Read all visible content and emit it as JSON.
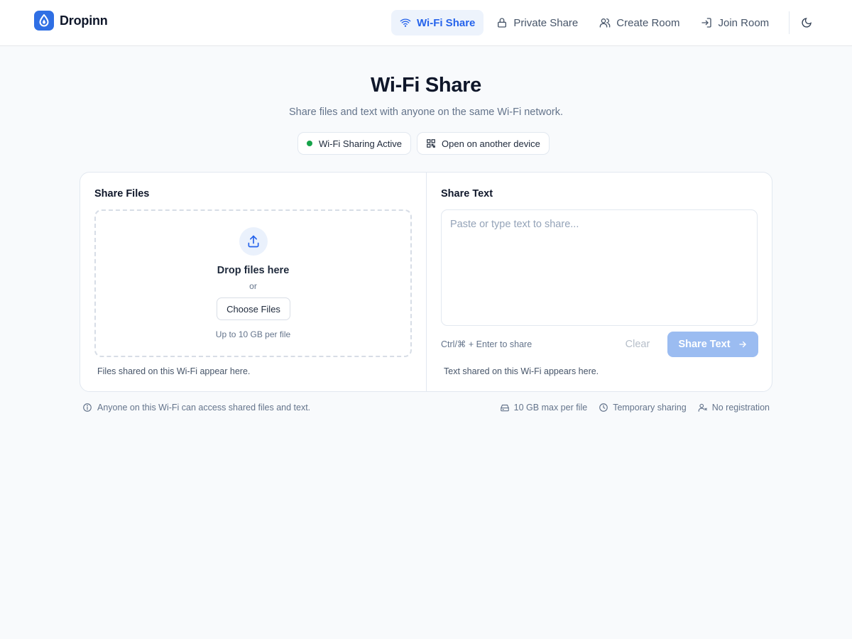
{
  "app": {
    "name": "Dropinn"
  },
  "nav": {
    "items": [
      {
        "label": "Wi-Fi Share",
        "icon": "wifi-icon",
        "active": true
      },
      {
        "label": "Private Share",
        "icon": "lock-icon",
        "active": false
      },
      {
        "label": "Create Room",
        "icon": "users-icon",
        "active": false
      },
      {
        "label": "Join Room",
        "icon": "login-icon",
        "active": false
      }
    ],
    "theme_toggle_icon": "moon-icon"
  },
  "hero": {
    "title": "Wi-Fi Share",
    "subtitle": "Share files and text with anyone on the same Wi-Fi network.",
    "status_pill": "Wi-Fi Sharing Active",
    "device_pill": "Open on another device"
  },
  "files": {
    "title": "Share Files",
    "drop_title": "Drop files here",
    "or": "or",
    "choose_label": "Choose Files",
    "limit": "Up to 10 GB per file",
    "empty_hint": "Files shared on this Wi-Fi appear here."
  },
  "text": {
    "title": "Share Text",
    "placeholder": "Paste or type text to share...",
    "value": "",
    "shortcut": "Ctrl/⌘ + Enter to share",
    "clear_label": "Clear",
    "share_label": "Share Text",
    "empty_hint": "Text shared on this Wi-Fi appears here."
  },
  "footer": {
    "notice": "Anyone on this Wi-Fi can access shared files and text.",
    "features": [
      {
        "label": "10 GB max per file",
        "icon": "drive-icon"
      },
      {
        "label": "Temporary sharing",
        "icon": "clock-icon"
      },
      {
        "label": "No registration",
        "icon": "user-x-icon"
      }
    ]
  },
  "colors": {
    "accent": "#2563eb",
    "background": "#f8fafc",
    "status_active": "#16a34a",
    "share_button_disabled": "#9bbcf1"
  }
}
